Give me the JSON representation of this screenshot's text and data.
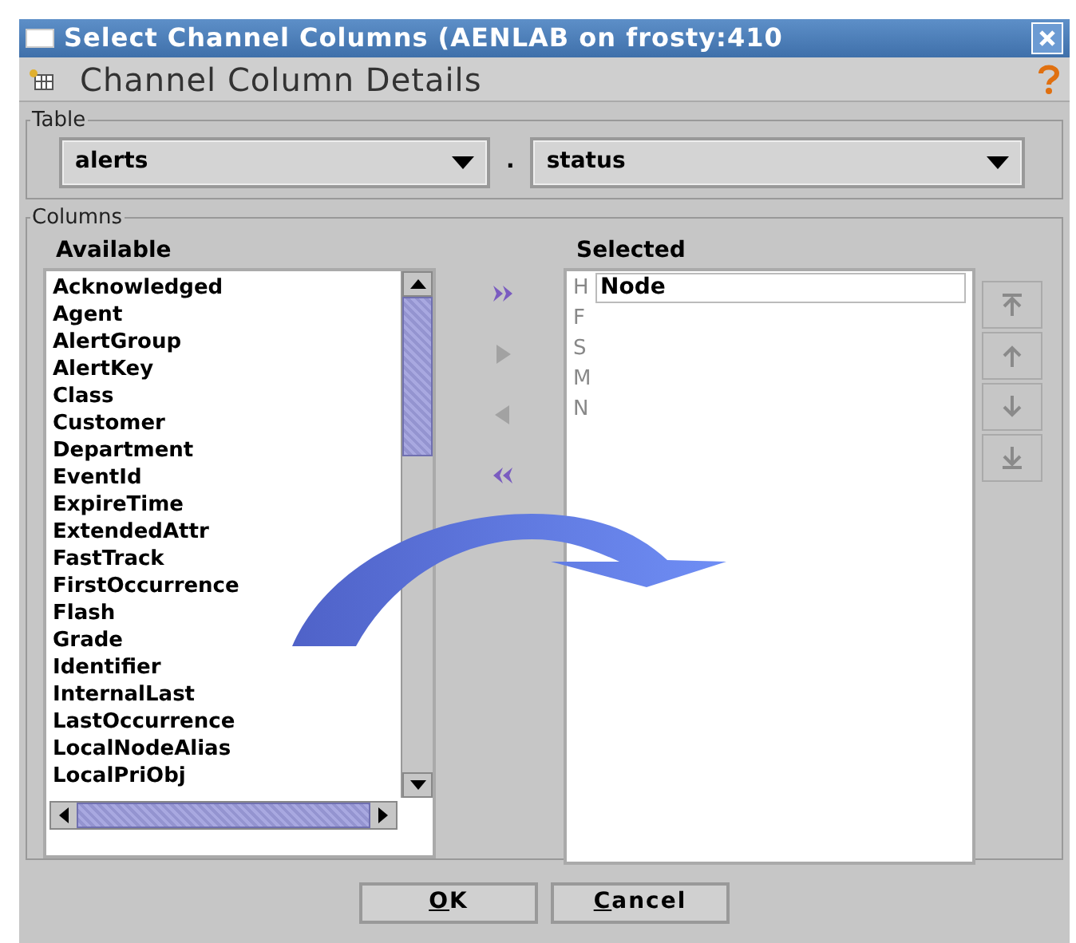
{
  "window": {
    "title": "Select Channel Columns (AENLAB on frosty:410"
  },
  "header": {
    "title": "Channel Column Details"
  },
  "table": {
    "legend": "Table",
    "database": "alerts",
    "separator": ".",
    "table": "status"
  },
  "columns": {
    "legend": "Columns",
    "available_label": "Available",
    "selected_label": "Selected",
    "available": [
      "Acknowledged",
      "Agent",
      "AlertGroup",
      "AlertKey",
      "Class",
      "Customer",
      "Department",
      "EventId",
      "ExpireTime",
      "ExtendedAttr",
      "FastTrack",
      "FirstOccurrence",
      "Flash",
      "Grade",
      "Identifier",
      "InternalLast",
      "LastOccurrence",
      "LocalNodeAlias",
      "LocalPriObj"
    ],
    "move_buttons": [
      {
        "kind": "add-all",
        "disabled": false
      },
      {
        "kind": "add",
        "disabled": true
      },
      {
        "kind": "remove",
        "disabled": true
      },
      {
        "kind": "remove-all",
        "disabled": false
      }
    ],
    "selected": [
      {
        "letter": "H",
        "value": "Node"
      },
      {
        "letter": "F"
      },
      {
        "letter": "S"
      },
      {
        "letter": "M"
      },
      {
        "letter": "N"
      }
    ],
    "order_buttons": [
      {
        "kind": "top",
        "disabled": true
      },
      {
        "kind": "up",
        "disabled": true
      },
      {
        "kind": "down",
        "disabled": true
      },
      {
        "kind": "bottom",
        "disabled": true
      }
    ]
  },
  "buttons": [
    {
      "label": "OK"
    },
    {
      "label": "Cancel"
    }
  ]
}
